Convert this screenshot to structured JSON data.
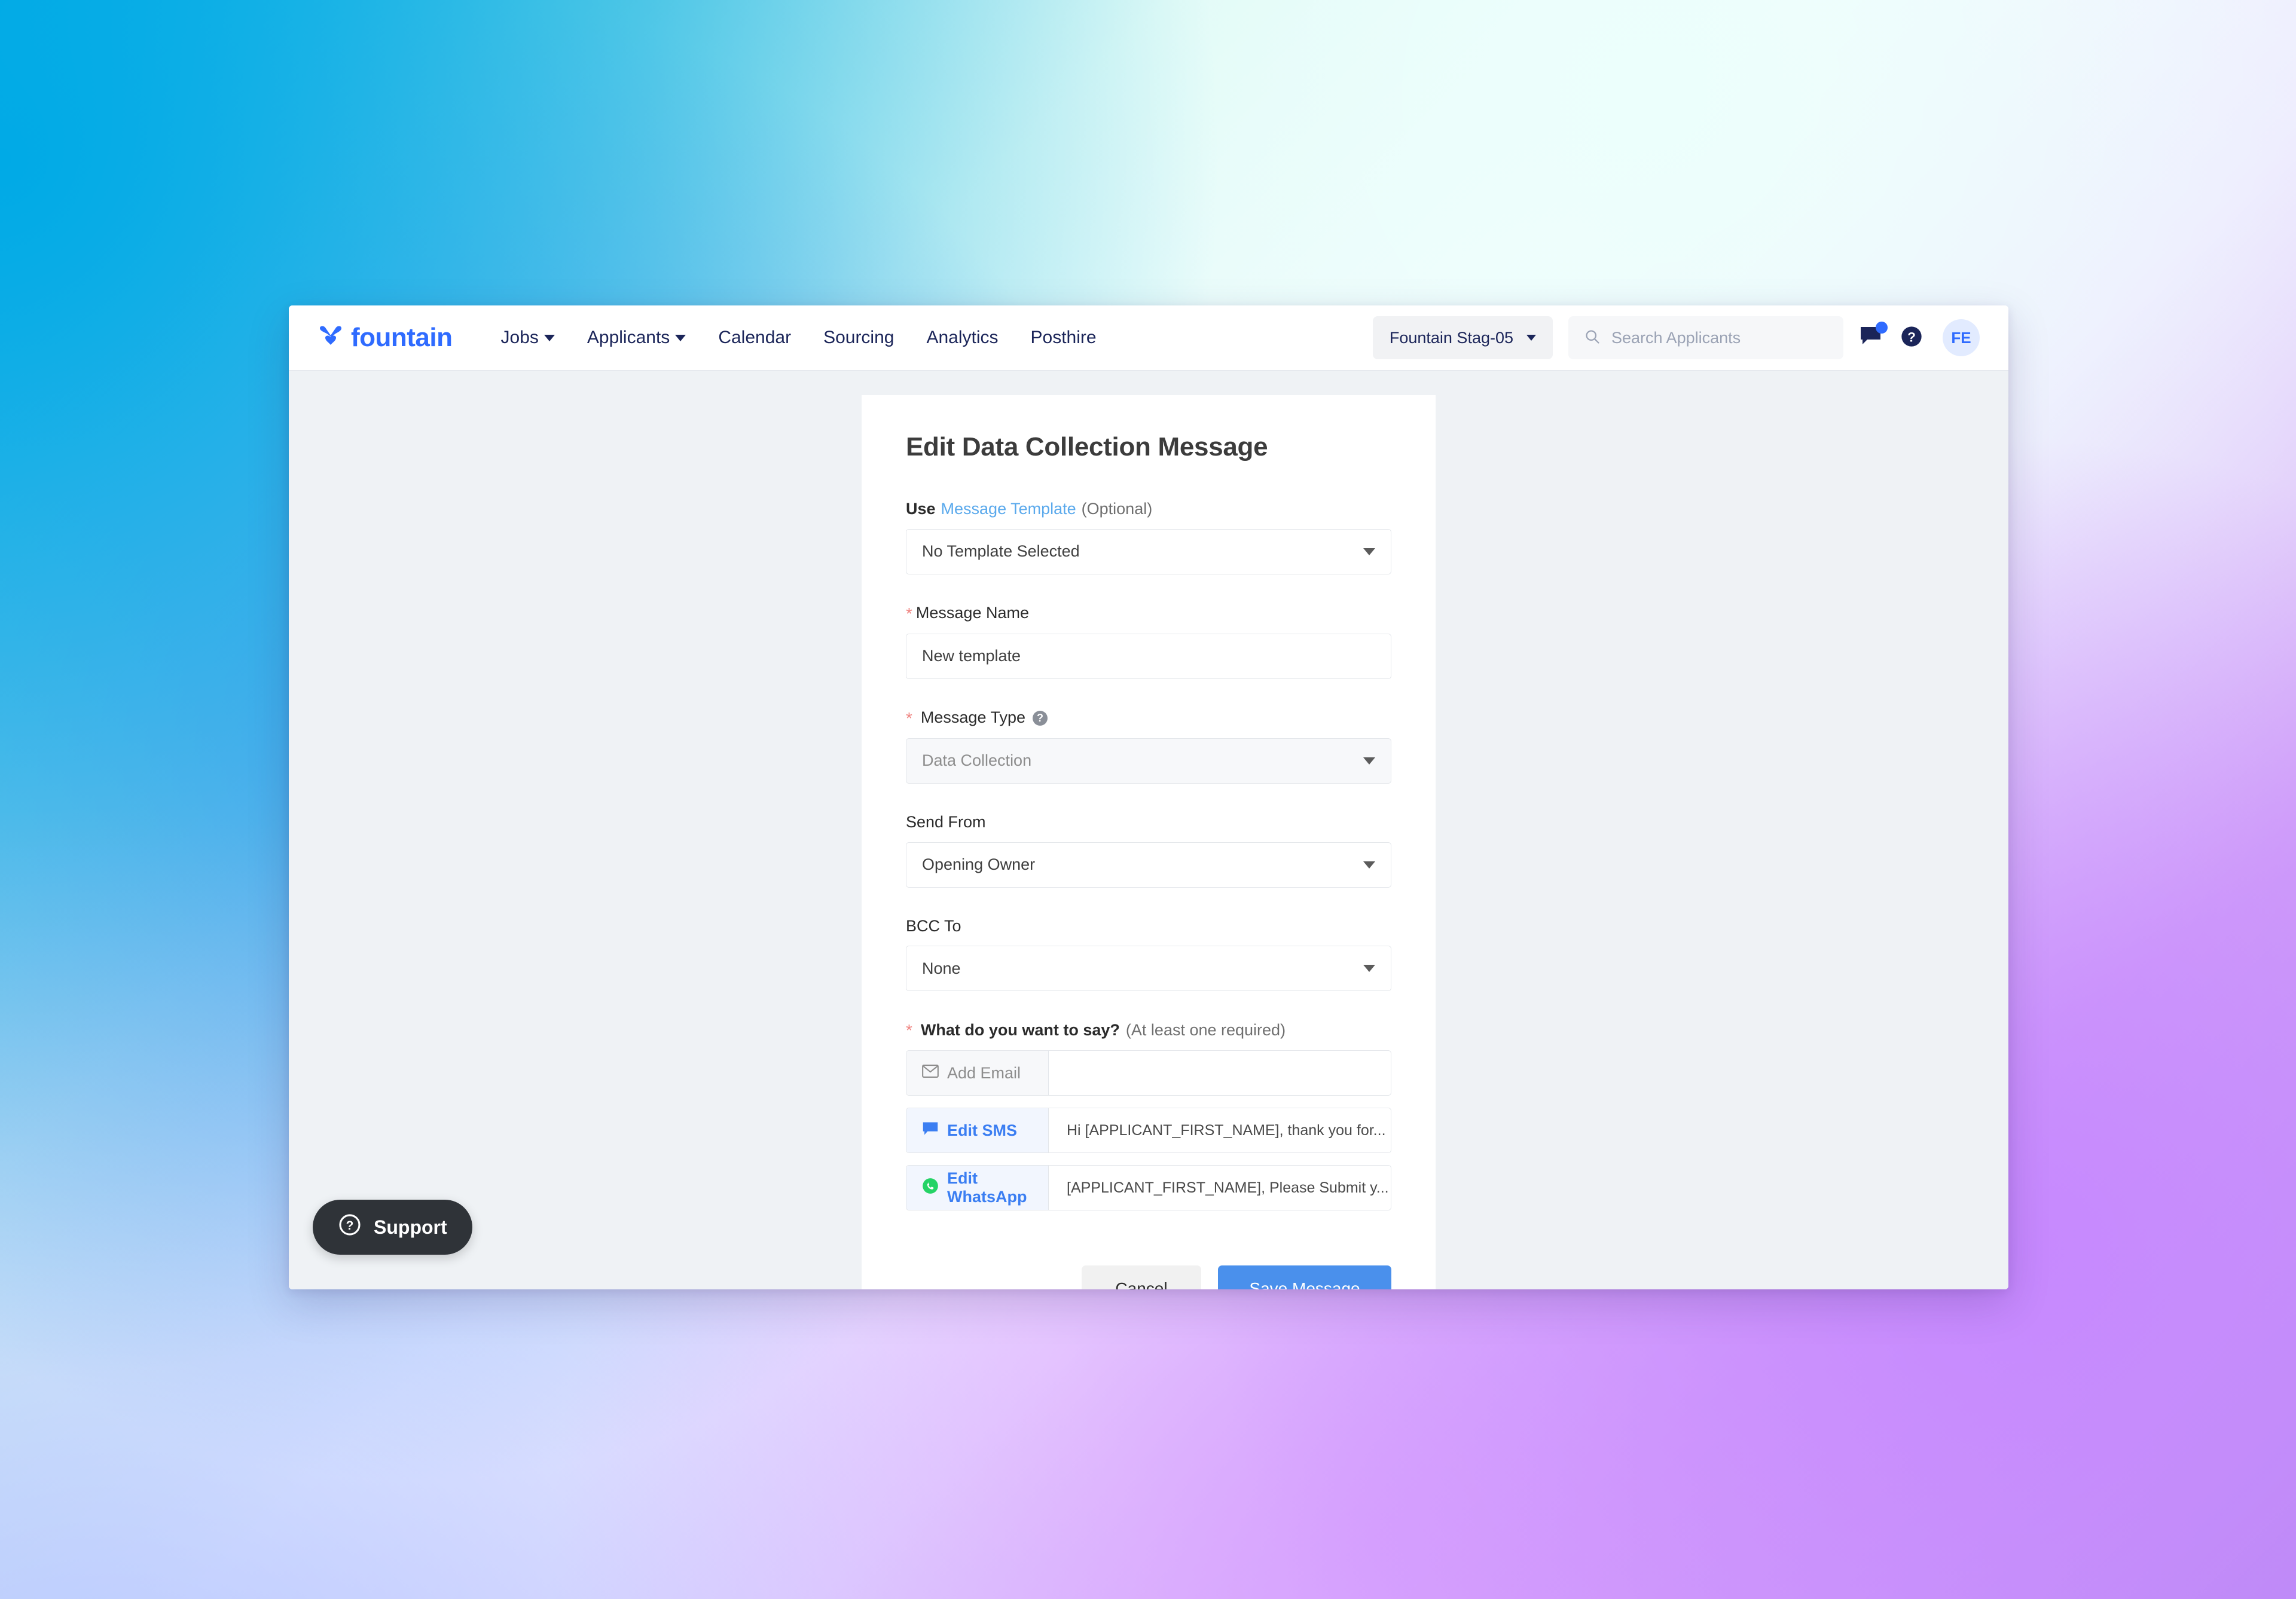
{
  "nav": {
    "brand": "fountain",
    "brand_icon": "fountain-logo-icon",
    "links": [
      {
        "label": "Jobs",
        "has_caret": true
      },
      {
        "label": "Applicants",
        "has_caret": true
      },
      {
        "label": "Calendar",
        "has_caret": false
      },
      {
        "label": "Sourcing",
        "has_caret": false
      },
      {
        "label": "Analytics",
        "has_caret": false
      },
      {
        "label": "Posthire",
        "has_caret": false
      }
    ],
    "account": "Fountain Stag-05",
    "search_placeholder": "Search Applicants",
    "search_value": "",
    "notifications_icon": "announcement-icon",
    "help_icon": "help-circle-icon",
    "avatar_initials": "FE"
  },
  "form": {
    "title": "Edit Data Collection Message",
    "template": {
      "label_prefix": "Use",
      "label_link": "Message Template",
      "label_suffix": "(Optional)",
      "value": "No Template Selected"
    },
    "message_name": {
      "label": "Message Name",
      "required": true,
      "value": "New template"
    },
    "message_type": {
      "label": "Message Type",
      "required": true,
      "value": "Data Collection",
      "disabled": true,
      "help": "?"
    },
    "send_from": {
      "label": "Send From",
      "value": "Opening Owner"
    },
    "bcc_to": {
      "label": "BCC To",
      "value": "None"
    },
    "say": {
      "label": "What do you want to say?",
      "hint": "(At least one required)",
      "required": true,
      "channels": [
        {
          "icon": "envelope-icon",
          "label": "Add Email",
          "state": "empty",
          "preview": ""
        },
        {
          "icon": "sms-bubble-icon",
          "label": "Edit SMS",
          "state": "filled",
          "preview": "Hi [APPLICANT_FIRST_NAME], thank you for..."
        },
        {
          "icon": "whatsapp-icon",
          "label": "Edit WhatsApp",
          "state": "filled",
          "preview": "[APPLICANT_FIRST_NAME], Please Submit y..."
        }
      ]
    },
    "actions": {
      "cancel": "Cancel",
      "save": "Save Message"
    }
  },
  "support": {
    "label": "Support",
    "icon": "question-circle-icon"
  },
  "colors": {
    "brand_blue": "#2f6bff",
    "link_blue": "#5aa9ec",
    "primary_button": "#4a90ec",
    "required_red": "#f08784",
    "whatsapp_green": "#25d366",
    "content_bg": "#eff2f5"
  }
}
